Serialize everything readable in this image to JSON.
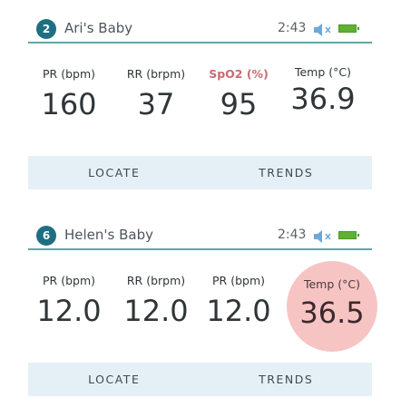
{
  "cards": [
    {
      "badge": "2",
      "name": "Ari's Baby",
      "time": "2:43",
      "icons": {
        "speaker": "muted-speaker-icon",
        "battery": "battery-full-icon"
      },
      "colors": {
        "accent": "#5fa6aa",
        "battery": "#5fb033",
        "speaker": "#6ea8d8"
      },
      "metrics": [
        {
          "label": "PR (bpm)",
          "value": "160"
        },
        {
          "label": "RR (brpm)",
          "value": "37"
        },
        {
          "label": "SpO2 (%)",
          "value": "95"
        },
        {
          "label": "Temp (°C)",
          "value": "36.9"
        }
      ],
      "actions": {
        "locate": "LOCATE",
        "trends": "TRENDS"
      }
    },
    {
      "badge": "6",
      "name": "Helen's Baby",
      "time": "2:43",
      "icons": {
        "speaker": "muted-speaker-icon",
        "battery": "battery-full-icon"
      },
      "colors": {
        "alert": "#f7c4c4",
        "alert_text": "#c86a73"
      },
      "metrics": [
        {
          "label": "PR (bpm)",
          "value": "12.0"
        },
        {
          "label": "RR (brpm)",
          "value": "12.0"
        },
        {
          "label": "PR (bpm)",
          "value": "12.0"
        },
        {
          "label": "Temp (°C)",
          "value": "36.5"
        }
      ],
      "actions": {
        "locate": "LOCATE",
        "trends": "TRENDS"
      }
    }
  ]
}
